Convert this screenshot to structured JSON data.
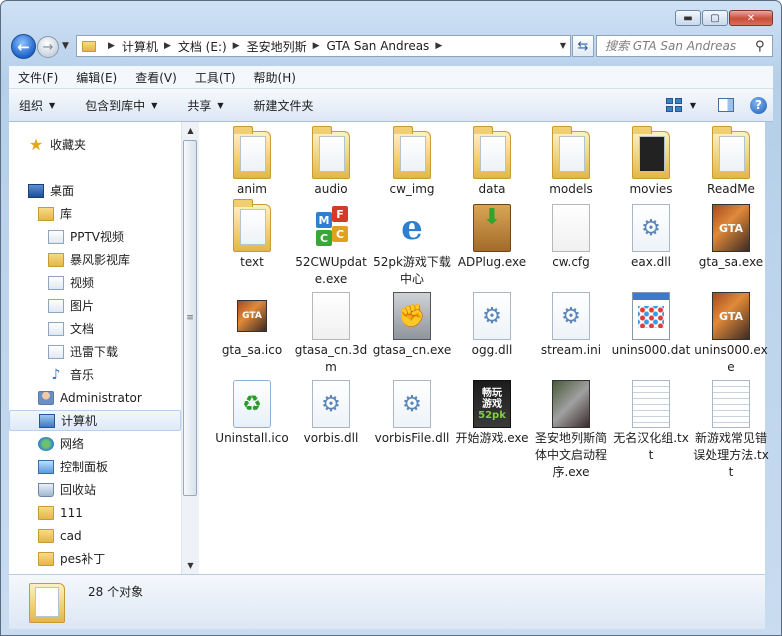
{
  "address": {
    "crumbs": [
      "计算机",
      "文档 (E:)",
      "圣安地列斯",
      "GTA San Andreas"
    ]
  },
  "search": {
    "placeholder": "搜索 GTA San Andreas"
  },
  "menu": [
    "文件(F)",
    "编辑(E)",
    "查看(V)",
    "工具(T)",
    "帮助(H)"
  ],
  "toolbar": {
    "organize": "组织",
    "include_library": "包含到库中",
    "share": "共享",
    "new_folder": "新建文件夹"
  },
  "nav": {
    "items": [
      {
        "label": "收藏夹",
        "icon": "star-icon"
      },
      {
        "label": "桌面",
        "icon": "desktop-icon"
      },
      {
        "label": "库",
        "icon": "library-icon"
      },
      {
        "label": "PPTV视频",
        "icon": "video-library-icon"
      },
      {
        "label": "暴风影视库",
        "icon": "folder-icon"
      },
      {
        "label": "视频",
        "icon": "video-library-icon"
      },
      {
        "label": "图片",
        "icon": "picture-library-icon"
      },
      {
        "label": "文档",
        "icon": "document-library-icon"
      },
      {
        "label": "迅雷下载",
        "icon": "download-library-icon"
      },
      {
        "label": "音乐",
        "icon": "music-icon"
      },
      {
        "label": "Administrator",
        "icon": "user-folder-icon"
      },
      {
        "label": "计算机",
        "icon": "computer-icon"
      },
      {
        "label": "网络",
        "icon": "network-icon"
      },
      {
        "label": "控制面板",
        "icon": "control-panel-icon"
      },
      {
        "label": "回收站",
        "icon": "recycle-bin-icon"
      },
      {
        "label": "111",
        "icon": "folder-icon"
      },
      {
        "label": "cad",
        "icon": "folder-icon"
      },
      {
        "label": "pes补丁",
        "icon": "folder-icon"
      }
    ]
  },
  "files": [
    {
      "name": "anim",
      "type": "folder"
    },
    {
      "name": "audio",
      "type": "folder"
    },
    {
      "name": "cw_img",
      "type": "folder"
    },
    {
      "name": "data",
      "type": "folder"
    },
    {
      "name": "models",
      "type": "folder"
    },
    {
      "name": "movies",
      "type": "folder"
    },
    {
      "name": "ReadMe",
      "type": "folder"
    },
    {
      "name": "text",
      "type": "folder"
    },
    {
      "name": "52CWUpdate.exe",
      "type": "mfc"
    },
    {
      "name": "52pk游戏下载中心",
      "type": "ie"
    },
    {
      "name": "ADPlug.exe",
      "type": "adplug"
    },
    {
      "name": "cw.cfg",
      "type": "doc"
    },
    {
      "name": "eax.dll",
      "type": "gear"
    },
    {
      "name": "gta_sa.exe",
      "type": "gta"
    },
    {
      "name": "gta_sa.ico",
      "type": "gta"
    },
    {
      "name": "gtasa_cn.3dm",
      "type": "doc"
    },
    {
      "name": "gtasa_cn.exe",
      "type": "fist"
    },
    {
      "name": "ogg.dll",
      "type": "gear"
    },
    {
      "name": "stream.ini",
      "type": "gear"
    },
    {
      "name": "unins000.dat",
      "type": "dat"
    },
    {
      "name": "unins000.exe",
      "type": "gta"
    },
    {
      "name": "Uninstall.ico",
      "type": "install"
    },
    {
      "name": "vorbis.dll",
      "type": "gear"
    },
    {
      "name": "vorbisFile.dll",
      "type": "gear"
    },
    {
      "name": "开始游戏.exe",
      "type": "game"
    },
    {
      "name": "圣安地列斯简体中文启动程序.exe",
      "type": "sa"
    },
    {
      "name": "无名汉化组.txt",
      "type": "txt"
    },
    {
      "name": "新游戏常见错误处理方法.txt",
      "type": "txt"
    }
  ],
  "game_icon": {
    "line1": "畅玩",
    "line2": "游戏",
    "line3": "52pk"
  },
  "gta_icon_text": "GTA",
  "status": {
    "count": "28 个对象"
  }
}
